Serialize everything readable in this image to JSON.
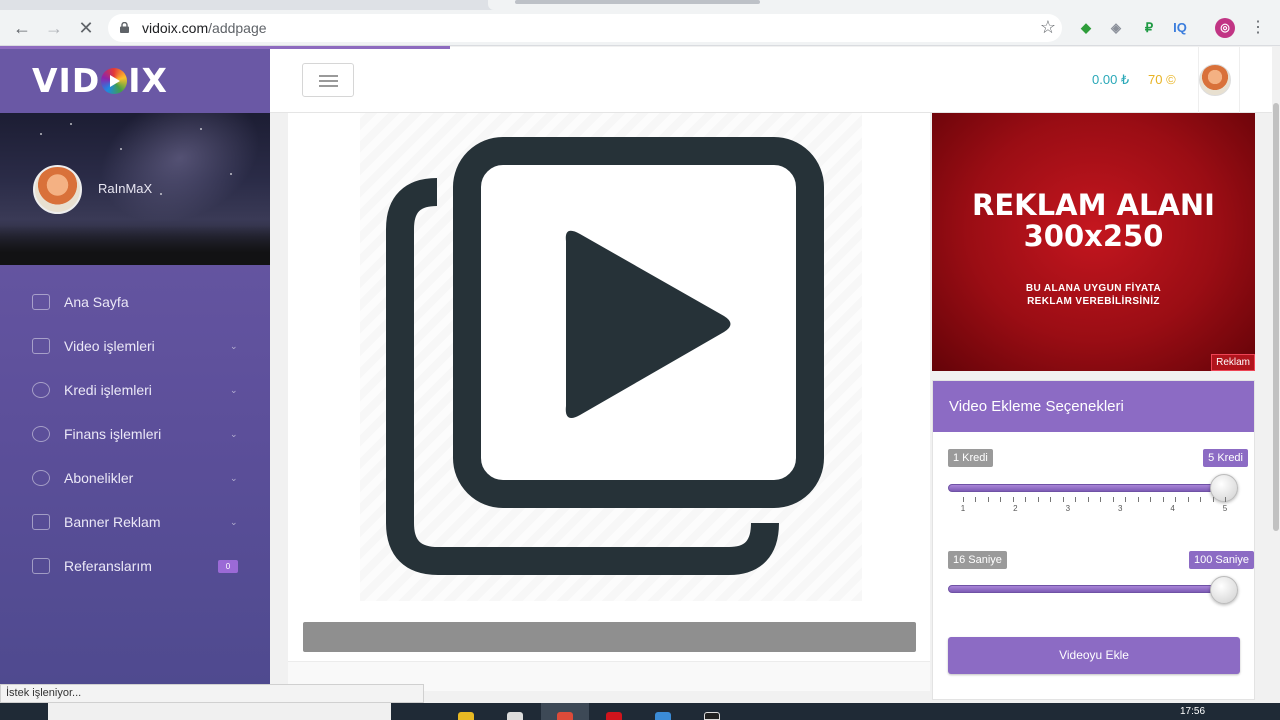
{
  "browser": {
    "url_host": "vidoix.com",
    "url_path": "/addpage",
    "status_text": "İstek işleniyor..."
  },
  "sidebar": {
    "brand": "VIDOIX",
    "username": "RaInMaX",
    "items": [
      {
        "label": "Ana Sayfa",
        "icon": "home-icon",
        "has_submenu": false
      },
      {
        "label": "Video işlemleri",
        "icon": "video-icon",
        "has_submenu": true
      },
      {
        "label": "Kredi işlemleri",
        "icon": "copyright-icon",
        "has_submenu": true
      },
      {
        "label": "Finans işlemleri",
        "icon": "dollar-icon",
        "has_submenu": true
      },
      {
        "label": "Abonelikler",
        "icon": "user-icon",
        "has_submenu": true
      },
      {
        "label": "Banner Reklam",
        "icon": "megaphone-icon",
        "has_submenu": true
      },
      {
        "label": "Referanslarım",
        "icon": "users-icon",
        "has_submenu": false,
        "badge": "0"
      }
    ]
  },
  "header": {
    "balance": "0.00 ₺",
    "credits": "70 ©"
  },
  "ad": {
    "title_line1": "REKLAM ALANI",
    "title_line2": "300x250",
    "sub_line1": "BU ALANA UYGUN FİYATA",
    "sub_line2": "REKLAM VEREBİLİRSİNİZ",
    "tag": "Reklam"
  },
  "options": {
    "title": "Video Ekleme Seçenekleri",
    "credit_slider": {
      "min_label": "1 Kredi",
      "max_label": "5 Kredi",
      "value_fraction": 1.0,
      "tick_labels": [
        "1",
        "2",
        "3",
        "3",
        "4",
        "5"
      ]
    },
    "seconds_slider": {
      "min_label": "16 Saniye",
      "max_label": "100 Saniye",
      "value_fraction": 1.0
    },
    "submit_label": "Videoyu Ekle"
  },
  "taskbar": {
    "clock": "17:56"
  },
  "colors": {
    "accent": "#8c6bc4",
    "balance": "#2aa8b8",
    "credits": "#e8b323",
    "ad_red": "#b0141c"
  }
}
